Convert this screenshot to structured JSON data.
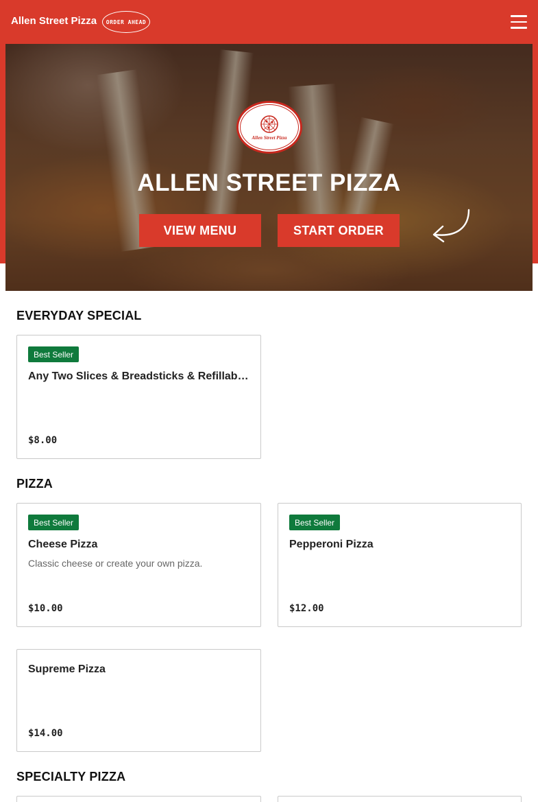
{
  "header": {
    "brand": "Allen Street Pizza",
    "order_ahead": "ORDER AHEAD",
    "menu_icon": "hamburger-menu-icon"
  },
  "hero": {
    "logo_text": "Allen Street Pizza",
    "title": "ALLEN STREET PIZZA",
    "view_menu": "VIEW MENU",
    "start_order": "START ORDER",
    "arrow_icon": "curved-arrow-icon"
  },
  "colors": {
    "brand_red": "#d93a2b",
    "badge_green": "#0f7a3c"
  },
  "sections": [
    {
      "title": "EVERYDAY SPECIAL",
      "items": [
        {
          "badge": "Best Seller",
          "name": "Any Two Slices & Breadsticks & Refillable…",
          "description": "",
          "price": "$8.00"
        }
      ]
    },
    {
      "title": "PIZZA",
      "items": [
        {
          "badge": "Best Seller",
          "name": "Cheese Pizza",
          "description": "Classic cheese or create your own pizza.",
          "price": "$10.00"
        },
        {
          "badge": "Best Seller",
          "name": "Pepperoni Pizza",
          "description": "",
          "price": "$12.00"
        },
        {
          "badge": "",
          "name": "Supreme Pizza",
          "description": "",
          "price": "$14.00"
        }
      ]
    },
    {
      "title": "SPECIALTY PIZZA",
      "items": []
    }
  ]
}
